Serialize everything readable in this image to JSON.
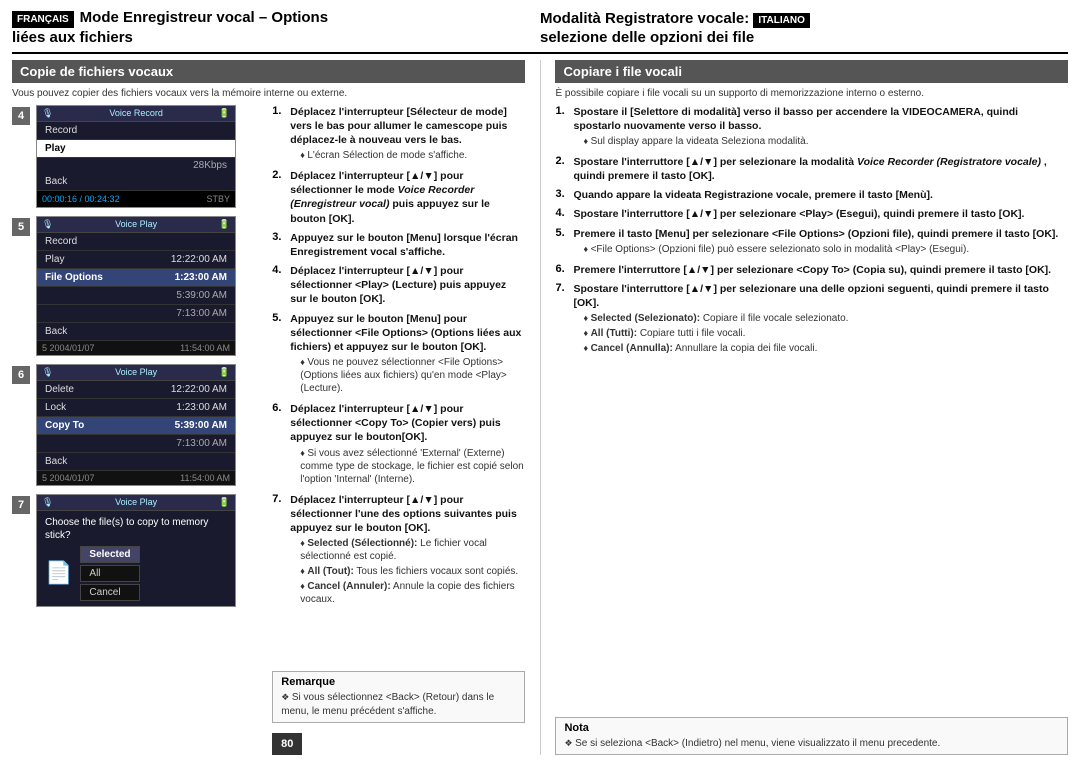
{
  "header": {
    "left_badge": "FRANÇAIS",
    "left_title_line1": "Mode Enregistreur vocal – Options",
    "left_title_line2": "liées aux fichiers",
    "right_title_line1": "Modalità Registratore vocale:",
    "right_title_line2": "selezione delle opzioni dei file",
    "right_badge": "ITALIANO"
  },
  "left_section": {
    "title": "Copie de fichiers vocaux",
    "intro": "Vous pouvez copier des fichiers vocaux vers la mémoire interne ou externe.",
    "steps": [
      {
        "num": "1.",
        "text": "Déplacez l'interrupteur [Sélecteur de mode] vers le bas pour allumer le camescope puis déplacez-le à nouveau vers le bas.",
        "bullets": [
          "L'écran Sélection de mode s'affiche."
        ]
      },
      {
        "num": "2.",
        "text": "Déplacez l'interrupteur [▲/▼] pour sélectionner le mode Voice Recorder (Enregistreur vocal) puis appuyez sur le bouton [OK].",
        "bullets": []
      },
      {
        "num": "3.",
        "text": "Appuyez sur le bouton [Menu] lorsque l'écran Enregistrement vocal s'affiche.",
        "bullets": []
      },
      {
        "num": "4.",
        "text": "Déplacez l'interrupteur [▲/▼] pour sélectionner <Play> (Lecture) puis appuyez sur le bouton [OK].",
        "bullets": []
      },
      {
        "num": "5.",
        "text": "Appuyez sur le bouton [Menu] pour sélectionner <File Options> (Options liées aux fichiers) et appuyez sur le bouton [OK].",
        "bullets": [
          "Vous ne pouvez sélectionner <File Options> (Options liées aux fichiers) qu'en mode <Play> (Lecture)."
        ]
      },
      {
        "num": "6.",
        "text": "Déplacez l'interrupteur [▲/▼] pour sélectionner <Copy To> (Copier vers) puis appuyez sur le bouton[OK].",
        "bullets": [
          "Si vous avez sélectionné 'External' (Externe) comme type de stockage, le fichier est copié selon l'option 'Internal' (Interne)."
        ]
      },
      {
        "num": "7.",
        "text": "Déplacez l'interrupteur [▲/▼] pour sélectionner l'une des options suivantes puis appuyez sur le bouton [OK].",
        "bullets": [
          "Selected (Sélectionné): Le fichier vocal sélectionné est copié.",
          "All (Tout): Tous les fichiers vocaux sont copiés.",
          "Cancel (Annuler): Annule la copie des fichiers vocaux."
        ]
      }
    ],
    "note_title": "Remarque",
    "note_text": "Si vous sélectionnez <Back> (Retour) dans le menu, le menu précédent s'affiche."
  },
  "right_section": {
    "title": "Copiare i file vocali",
    "intro": "È possibile copiare i file vocali su un supporto di memorizzazione interno o esterno.",
    "steps": [
      {
        "num": "1.",
        "text": "Spostare il [Selettore di modalità] verso il basso per accendere la VIDEOCAMERA, quindi spostarlo nuovamente verso il basso.",
        "bullets": [
          "Sul display appare la videata Seleziona modalità."
        ]
      },
      {
        "num": "2.",
        "text": "Spostare l'interruttore [▲/▼] per selezionare la modalità Voice Recorder (Registratore vocale) , quindi premere il tasto [OK].",
        "bullets": []
      },
      {
        "num": "3.",
        "text": "Quando appare la videata Registrazione vocale, premere il tasto [Menù].",
        "bullets": []
      },
      {
        "num": "4.",
        "text": "Spostare l'interruttore [▲/▼] per selezionare <Play> (Esegui), quindi premere il tasto [OK].",
        "bullets": []
      },
      {
        "num": "5.",
        "text": "Premere il tasto [Menu] per selezionare <File Options> (Opzioni file), quindi premere il tasto [OK].",
        "bullets": [
          "<File Options> (Opzioni file) può essere selezionato solo in modalità <Play> (Esegui)."
        ]
      },
      {
        "num": "6.",
        "text": "Premere l'interruttore [▲/▼] per selezionare <Copy To> (Copia su), quindi premere il tasto [OK].",
        "bullets": []
      },
      {
        "num": "7.",
        "text": "Spostare l'interruttore [▲/▼] per selezionare una delle opzioni seguenti, quindi premere il tasto [OK].",
        "bullets": [
          "Selected (Selezionato): Copiare il file vocale selezionato.",
          "All (Tutti): Copiare tutti i file vocali.",
          "Cancel (Annulla): Annullare la copia dei file vocali."
        ]
      }
    ],
    "note_title": "Nota",
    "note_text": "Se si seleziona <Back> (Indietro) nel menu, viene visualizzato il menu precedente."
  },
  "screens": [
    {
      "num": "4",
      "header_label": "Voice Record",
      "menu_items": [
        "Record",
        "Play",
        "Back"
      ],
      "selected_item": "Play",
      "show_bitrate": "28Kbps",
      "status": "00:00:16 / 00:24:32",
      "stby": "STBY"
    },
    {
      "num": "5",
      "header_label": "Voice Play",
      "menu_items": [
        "Record",
        "Play",
        "File Options",
        "Back"
      ],
      "selected_item": "File Options",
      "times": [
        "12:22:00 AM",
        "1:23:00 AM",
        "5:39:00 AM",
        "7:13:00 AM",
        "11:54:00 AM"
      ],
      "footer": "5  2004/01/07"
    },
    {
      "num": "6",
      "header_label": "Voice Play",
      "menu_items": [
        "Delete",
        "Lock",
        "Copy To",
        "Back"
      ],
      "selected_item": "Copy To",
      "times": [
        "12:22:00 AM",
        "1:23:00 AM",
        "5:39:00 AM",
        "7:13:00 AM",
        "11:54:00 AM"
      ],
      "footer": "5  2004/01/07"
    },
    {
      "num": "7",
      "header_label": "Voice Play",
      "question": "Choose the file(s) to copy to memory stick?",
      "options": [
        "Selected",
        "All",
        "Cancel"
      ],
      "selected_option": "Selected"
    }
  ],
  "page_number": "80"
}
